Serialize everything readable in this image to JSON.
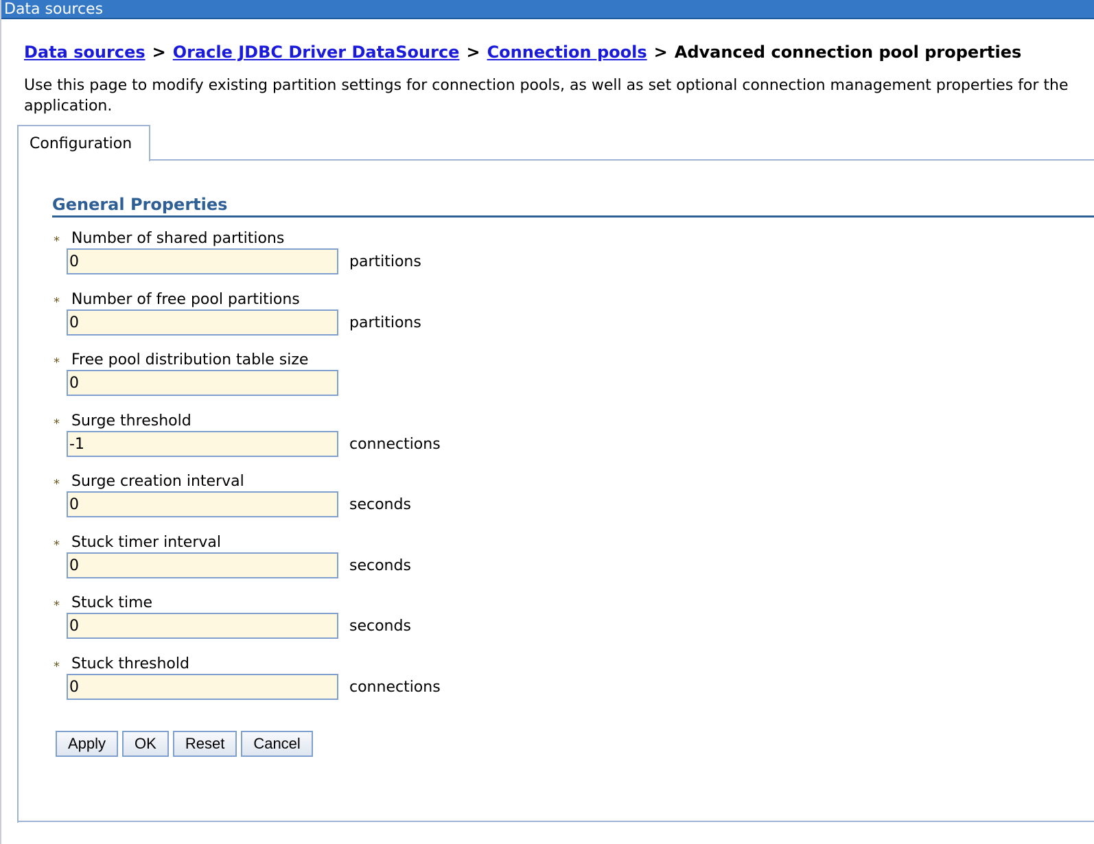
{
  "window": {
    "title": "Data sources"
  },
  "breadcrumb": {
    "items": [
      {
        "label": "Data sources"
      },
      {
        "label": "Oracle JDBC Driver DataSource"
      },
      {
        "label": "Connection pools"
      }
    ],
    "separator": ">",
    "current": "Advanced connection pool properties"
  },
  "description": "Use this page to modify existing partition settings for connection pools, as well as set optional connection management properties for the application.",
  "tabs": [
    {
      "label": "Configuration",
      "active": true
    }
  ],
  "section": {
    "title": "General Properties"
  },
  "required_marker": "*",
  "fields": [
    {
      "label": "Number of shared partitions",
      "value": "0",
      "unit": "partitions"
    },
    {
      "label": "Number of free pool partitions",
      "value": "0",
      "unit": "partitions"
    },
    {
      "label": "Free pool distribution table size",
      "value": "0",
      "unit": ""
    },
    {
      "label": "Surge threshold",
      "value": "-1",
      "unit": "connections"
    },
    {
      "label": "Surge creation interval",
      "value": "0",
      "unit": "seconds"
    },
    {
      "label": "Stuck timer interval",
      "value": "0",
      "unit": "seconds"
    },
    {
      "label": "Stuck time",
      "value": "0",
      "unit": "seconds"
    },
    {
      "label": "Stuck threshold",
      "value": "0",
      "unit": "connections"
    }
  ],
  "buttons": {
    "apply": "Apply",
    "ok": "OK",
    "reset": "Reset",
    "cancel": "Cancel"
  },
  "colors": {
    "titlebar": "#3478c6",
    "link": "#1a1adb",
    "section_title": "#2e6096",
    "input_background": "#fff8e0",
    "input_border": "#7f9fcf"
  }
}
